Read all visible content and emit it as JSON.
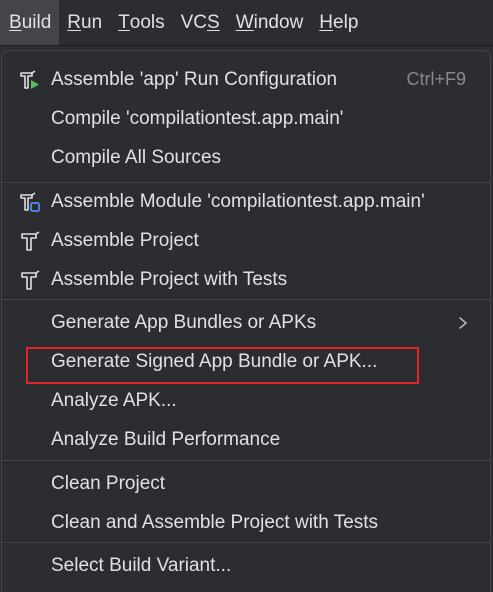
{
  "menubar": {
    "items": [
      {
        "label": "Build",
        "mnemonic": "B"
      },
      {
        "label": "Run",
        "mnemonic": "R"
      },
      {
        "label": "Tools",
        "mnemonic": "T"
      },
      {
        "label": "VCS",
        "mnemonic": "S"
      },
      {
        "label": "Window",
        "mnemonic": "W"
      },
      {
        "label": "Help",
        "mnemonic": "H"
      }
    ]
  },
  "build_menu": {
    "items": [
      {
        "label": "Assemble 'app' Run Configuration",
        "shortcut": "Ctrl+F9",
        "icon": "hammer-run-icon"
      },
      {
        "label": "Compile 'compilationtest.app.main'"
      },
      {
        "label": "Compile All Sources"
      },
      {
        "label": "Assemble Module 'compilationtest.app.main'",
        "icon": "hammer-module-icon"
      },
      {
        "label": "Assemble Project",
        "icon": "hammer-icon"
      },
      {
        "label": "Assemble Project with Tests",
        "icon": "hammer-icon"
      },
      {
        "label": "Generate App Bundles or APKs",
        "submenu": true
      },
      {
        "label": "Generate Signed App Bundle or APK...",
        "highlighted": true
      },
      {
        "label": "Analyze APK..."
      },
      {
        "label": "Analyze Build Performance"
      },
      {
        "label": "Clean Project"
      },
      {
        "label": "Clean and Assemble Project with Tests"
      },
      {
        "label": "Select Build Variant..."
      }
    ]
  },
  "colors": {
    "background": "#2b2d30",
    "text": "#dfe1e5",
    "shortcut": "#868a91",
    "separator": "#43454a",
    "annotation_box": "#e0262b",
    "run_accent": "#5fb865",
    "module_accent": "#548af7"
  }
}
